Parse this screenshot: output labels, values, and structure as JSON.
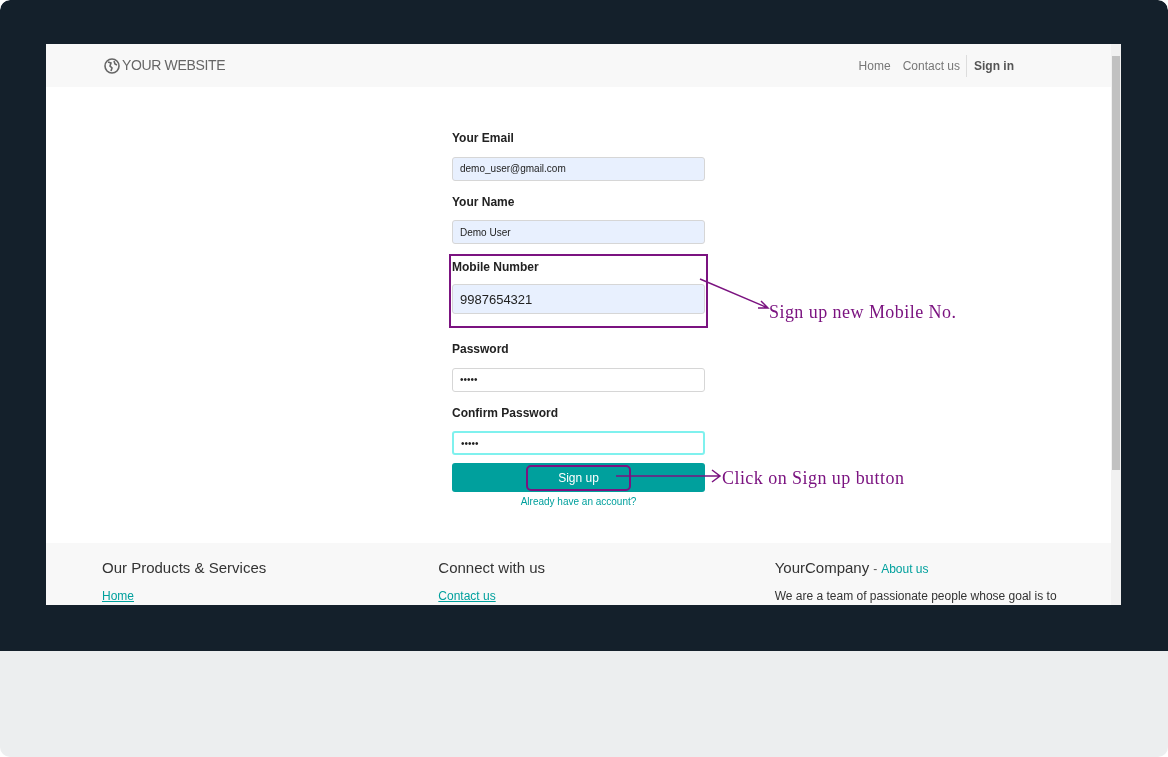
{
  "navbar": {
    "logo": "YOUR WEBSITE",
    "links": [
      {
        "label": "Home",
        "selected": false
      },
      {
        "label": "Contact us",
        "selected": false
      },
      {
        "label": "Sign in",
        "selected": true
      }
    ]
  },
  "form": {
    "fields": [
      {
        "label": "Your Email",
        "value": "demo_user@gmail.com",
        "autofilled": true,
        "focused": false,
        "highlighted": false
      },
      {
        "label": "Your Name",
        "value": "Demo User",
        "autofilled": true,
        "focused": false,
        "highlighted": false
      },
      {
        "label": "Mobile Number",
        "value": "9987654321",
        "autofilled": true,
        "focused": false,
        "highlighted": true
      },
      {
        "label": "Password",
        "value": "•••••",
        "autofilled": false,
        "focused": false,
        "highlighted": false
      },
      {
        "label": "Confirm Password",
        "value": "•••••",
        "autofilled": false,
        "focused": true,
        "highlighted": false
      }
    ],
    "submit": {
      "label": "Sign up",
      "highlighted": true
    },
    "login_link": "Already have an account?"
  },
  "annotations": [
    "Sign up new Mobile No.",
    "Click on Sign up button"
  ],
  "footer": {
    "columns": [
      {
        "title": "Our Products & Services",
        "link": "Home"
      },
      {
        "title": "Connect with us",
        "link": "Contact us"
      },
      {
        "title": "YourCompany",
        "separator": "-",
        "title_link": "About us",
        "text": "We are a team of passionate people whose goal is to"
      }
    ]
  }
}
